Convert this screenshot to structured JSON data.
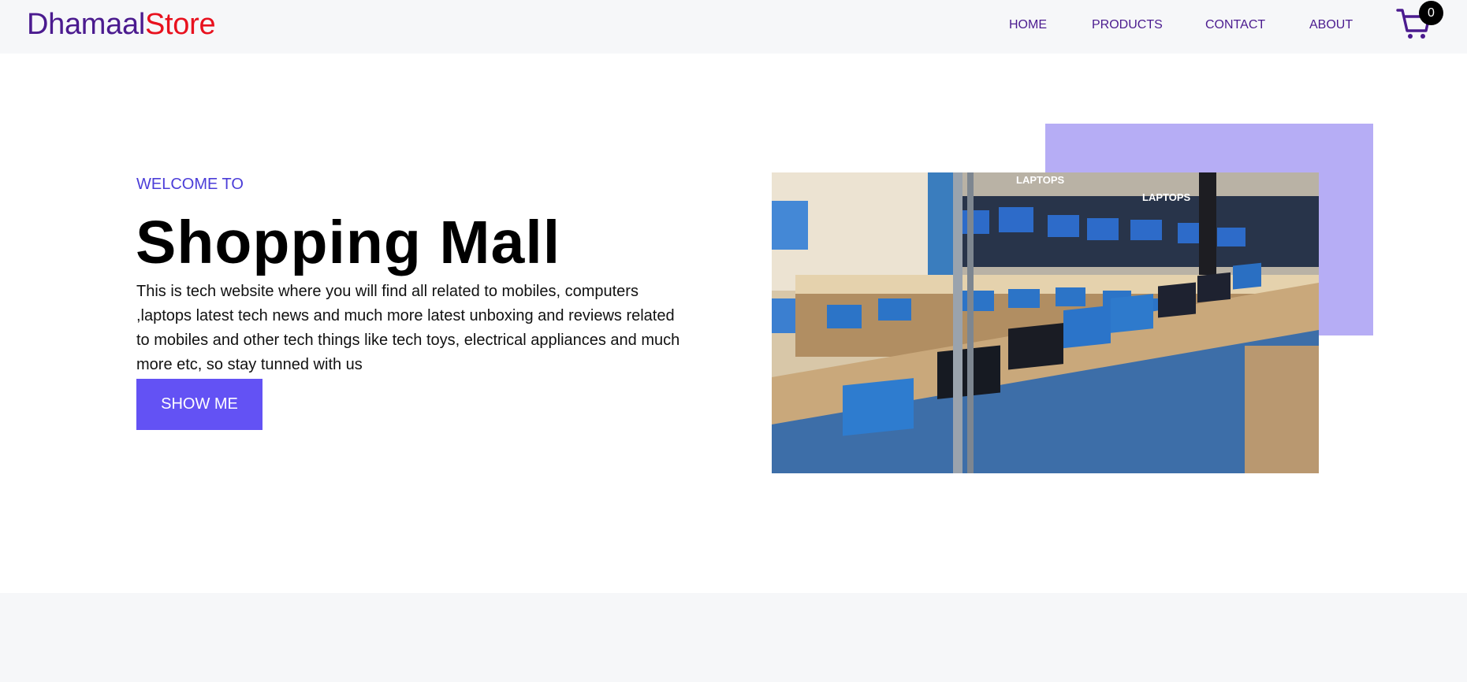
{
  "brand": {
    "part1": "Dhamaal",
    "part2": "Store"
  },
  "nav": {
    "items": [
      {
        "label": "HOME"
      },
      {
        "label": "PRODUCTS"
      },
      {
        "label": "CONTACT"
      },
      {
        "label": "ABOUT"
      }
    ]
  },
  "cart": {
    "icon": "cart-icon",
    "count": "0"
  },
  "hero": {
    "kicker": "WELCOME TO",
    "title": "Shopping Mall",
    "description": "This is tech website where you will find all related to mobiles, computers ,laptops latest tech news and much more latest unboxing and reviews related to mobiles and other tech things like tech toys, electrical appliances and much more etc, so stay tunned with us",
    "button_label": "SHOW ME",
    "image_alt": "laptop store display"
  },
  "colors": {
    "brand_primary": "#4b1b8f",
    "brand_accent": "#e8111e",
    "button_bg": "#6352f4",
    "accent_box": "#b6adf5",
    "header_bg": "#f6f7f9"
  }
}
